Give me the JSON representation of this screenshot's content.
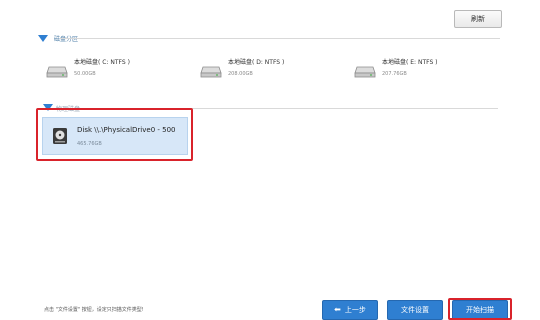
{
  "toolbar": {
    "refresh_label": "刷新"
  },
  "partition_section": {
    "title": "磁盘分区"
  },
  "partitions": [
    {
      "name": "本地磁盘( C: NTFS )",
      "size": "50.00GB"
    },
    {
      "name": "本地磁盘( D: NTFS )",
      "size": "208.00GB"
    },
    {
      "name": "本地磁盘( E: NTFS )",
      "size": "207.76GB"
    }
  ],
  "physical_section": {
    "title": "物理磁盘"
  },
  "physical_disk": {
    "name": "Disk \\\\.\\PhysicalDrive0 - 500",
    "size": "465.76GB"
  },
  "footer": {
    "hint": "点击 \"文件设置\" 按钮，设定只扫描文件类型!",
    "back_label": "上一步",
    "file_settings_label": "文件设置",
    "start_scan_label": "开始扫描"
  },
  "colors": {
    "accent": "#2f7fd1",
    "highlight": "#d9232b",
    "selected_bg": "#d7e7f8"
  }
}
